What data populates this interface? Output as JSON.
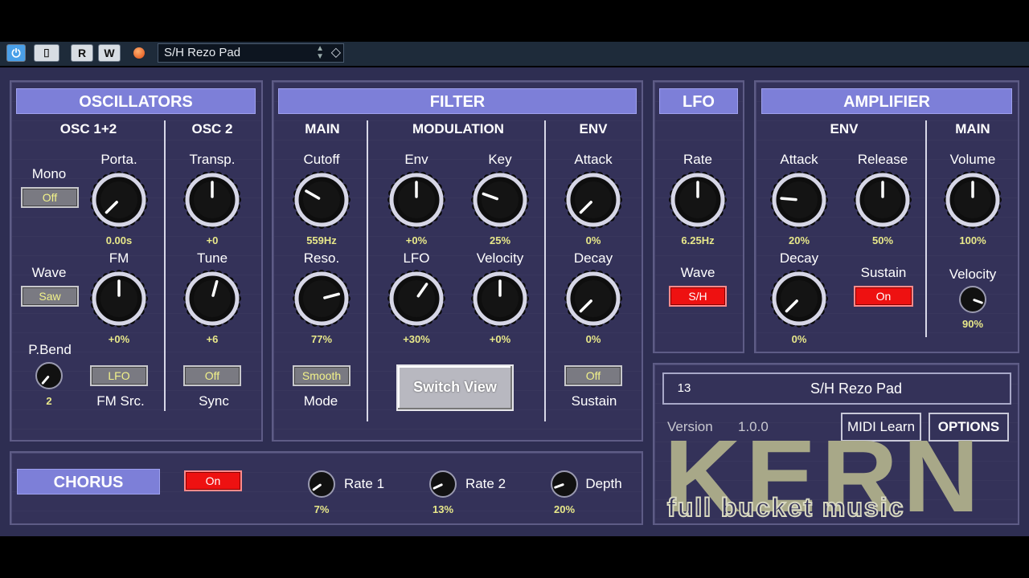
{
  "host": {
    "preset_name": "S/H Rezo Pad",
    "buttons": {
      "power": "power-icon",
      "bypass": "bypass-icon",
      "read": "R",
      "write": "W"
    }
  },
  "oscillators": {
    "title": "OSCILLATORS",
    "osc12_label": "OSC 1+2",
    "osc2_label": "OSC 2",
    "mono_label": "Mono",
    "mono_value": "Off",
    "wave_label": "Wave",
    "wave_value": "Saw",
    "pbend_label": "P.Bend",
    "pbend_value": "2",
    "porta_label": "Porta.",
    "porta_value": "0.00s",
    "fm_label": "FM",
    "fm_value": "+0%",
    "fmsrc_button": "LFO",
    "fmsrc_label": "FM Src.",
    "transp_label": "Transp.",
    "transp_value": "+0",
    "tune_label": "Tune",
    "tune_value": "+6",
    "sync_button": "Off",
    "sync_label": "Sync"
  },
  "filter": {
    "title": "FILTER",
    "main_label": "MAIN",
    "mod_label": "MODULATION",
    "env_label": "ENV",
    "cutoff_label": "Cutoff",
    "cutoff_value": "559Hz",
    "reso_label": "Reso.",
    "reso_value": "77%",
    "mode_button": "Smooth",
    "mode_label": "Mode",
    "env_label2": "Env",
    "env_value": "+0%",
    "key_label": "Key",
    "key_value": "25%",
    "lfo_label": "LFO",
    "lfo_value": "+30%",
    "velocity_label": "Velocity",
    "velocity_value": "+0%",
    "switch_view": "Switch View",
    "attack_label": "Attack",
    "attack_value": "0%",
    "decay_label": "Decay",
    "decay_value": "0%",
    "sustain_button": "Off",
    "sustain_label": "Sustain"
  },
  "lfo": {
    "title": "LFO",
    "rate_label": "Rate",
    "rate_value": "6.25Hz",
    "wave_label": "Wave",
    "wave_value": "S/H"
  },
  "amplifier": {
    "title": "AMPLIFIER",
    "env_label": "ENV",
    "main_label": "MAIN",
    "attack_label": "Attack",
    "attack_value": "20%",
    "release_label": "Release",
    "release_value": "50%",
    "decay_label": "Decay",
    "decay_value": "0%",
    "sustain_label": "Sustain",
    "sustain_value": "On",
    "volume_label": "Volume",
    "volume_value": "100%",
    "velocity_label": "Velocity",
    "velocity_value": "90%"
  },
  "chorus": {
    "title": "CHORUS",
    "enabled": "On",
    "rate1_label": "Rate 1",
    "rate1_value": "7%",
    "rate2_label": "Rate 2",
    "rate2_value": "13%",
    "depth_label": "Depth",
    "depth_value": "20%"
  },
  "program": {
    "number": "13",
    "name": "S/H Rezo Pad",
    "version_label": "Version",
    "version_value": "1.0.0",
    "midi_learn": "MIDI Learn",
    "options": "OPTIONS",
    "logo_text": "KERN",
    "logo_sub": "full bucket music"
  },
  "knob_angles": {
    "porta": -135,
    "fm": 0,
    "transp": 0,
    "tune": 15,
    "cutoff": -60,
    "reso": 75,
    "env": 0,
    "key": -70,
    "lfo": 35,
    "velocity": 0,
    "attack": -135,
    "decay": -135,
    "lfo_rate": 0,
    "amp_attack": -85,
    "amp_release": 0,
    "amp_decay": -135,
    "volume": 0,
    "amp_velocity": 110,
    "pbend": -140,
    "chorus_rate1": -125,
    "chorus_rate2": -115,
    "chorus_depth": -110
  },
  "colors": {
    "panel": "#343259",
    "header": "#7d7fd8",
    "value_text": "#e8e88a",
    "button_on": "#ee1111"
  }
}
